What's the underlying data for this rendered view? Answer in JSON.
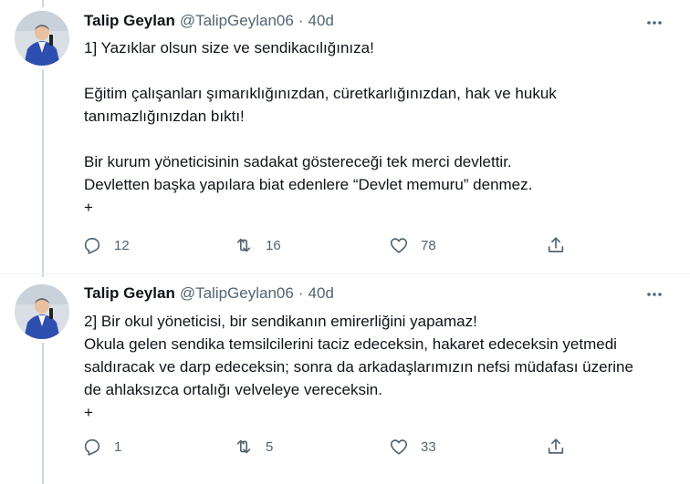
{
  "tweets": [
    {
      "author_name": "Talip Geylan",
      "handle": "@TalipGeylan06",
      "separator": "·",
      "time": "40d",
      "text": "1] Yazıklar olsun size ve sendikacılığınıza!\n\nEğitim çalışanları şımarıklığınızdan, cüretkarlığınızdan, hak ve hukuk tanımazlığınızdan bıktı!\n\nBir kurum yöneticisinin sadakat göstereceği tek merci devlettir.\nDevletten başka yapılara biat edenlere “Devlet memuru” denmez.\n+",
      "replies": "12",
      "retweets": "16",
      "likes": "78"
    },
    {
      "author_name": "Talip Geylan",
      "handle": "@TalipGeylan06",
      "separator": "·",
      "time": "40d",
      "text": "2] Bir okul yöneticisi, bir sendikanın emirerliğini yapamaz!\nOkula gelen sendika temsilcilerini taciz edeceksin, hakaret edeceksin yetmedi saldıracak ve darp edeceksin; sonra da arkadaşlarımızın nefsi müdafası üzerine de ahlaksızca ortalığı velveleye vereceksin.\n+",
      "replies": "1",
      "retweets": "5",
      "likes": "33"
    }
  ],
  "icons": {
    "more": "more-icon",
    "reply": "reply-icon",
    "retweet": "retweet-icon",
    "like": "heart-icon",
    "share": "share-icon"
  },
  "colors": {
    "muted": "#536471",
    "text": "#0f1419",
    "thread_line": "#cfd9de",
    "avatar_jacket": "#2f4fb0"
  }
}
